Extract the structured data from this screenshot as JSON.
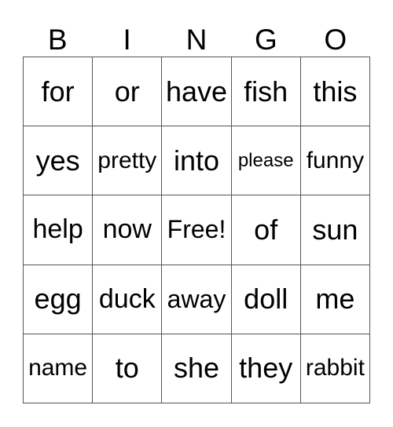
{
  "header": {
    "letters": [
      "B",
      "I",
      "N",
      "G",
      "O"
    ]
  },
  "card": {
    "rows": [
      [
        "for",
        "or",
        "have",
        "fish",
        "this"
      ],
      [
        "yes",
        "pretty",
        "into",
        "please",
        "funny"
      ],
      [
        "help",
        "now",
        "Free!",
        "of",
        "sun"
      ],
      [
        "egg",
        "duck",
        "away",
        "doll",
        "me"
      ],
      [
        "name",
        "to",
        "she",
        "they",
        "rabbit"
      ]
    ],
    "free_space": "Free!"
  }
}
